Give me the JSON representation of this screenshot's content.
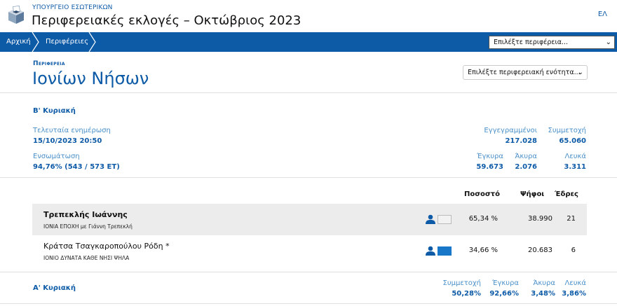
{
  "header": {
    "ministry": "ΥΠΟΥΡΓΕΙΟ ΕΣΩΤΕΡΙΚΩΝ",
    "title": "Περιφερειακές εκλογές – Οκτώβριος 2023",
    "lang": "ΕΛ"
  },
  "nav": {
    "crumbs": [
      "Αρχική",
      "Περιφέρειες"
    ],
    "region_select": "Επιλέξτε περιφέρεια..."
  },
  "region": {
    "label": "Περιφερεια",
    "name": "Ιονίων Νήσων",
    "unit_select": "Επιλέξτε περιφερειακή ενότητα..."
  },
  "round2": {
    "title": "Β' Κυριακή",
    "last_update_label": "Τελευταία ενημέρωση",
    "last_update": "15/10/2023 20:50",
    "integration_label": "Ενσωμάτωση",
    "integration": "94,76% (543 / 573 ΕΤ)",
    "registered_label": "Εγγεγραμμένοι",
    "registered": "217.028",
    "turnout_label": "Συμμετοχή",
    "turnout": "65.060",
    "valid_label": "Έγκυρα",
    "valid": "59.673",
    "invalid_label": "Άκυρα",
    "invalid": "2.076",
    "blank_label": "Λευκά",
    "blank": "3.311"
  },
  "results": {
    "headers": {
      "percent": "Ποσοστό",
      "votes": "Ψήφοι",
      "seats": "Έδρες"
    },
    "candidates": [
      {
        "name": "Τρεπεκλής Ιωάννης",
        "party": "ΙΟΝΙΑ ΕΠΟΧΗ με Γιάννη Τρεπεκλή",
        "percent": "65,34 %",
        "votes": "38.990",
        "seats": "21",
        "color": "#f2f2f2"
      },
      {
        "name": "Κράτσα Τσαγκαροπούλου Ρόδη *",
        "party": "ΙΟΝΙΟ ΔΥΝΑΤΑ ΚΑΘΕ ΝΗΣΙ ΨΗΛΑ",
        "percent": "34,66 %",
        "votes": "20.683",
        "seats": "6",
        "color": "#1877c9"
      }
    ]
  },
  "round1": {
    "title": "Α' Κυριακή",
    "turnout_label": "Συμμετοχή",
    "turnout": "50,28%",
    "valid_label": "Έγκυρα",
    "valid": "92,66%",
    "invalid_label": "Άκυρα",
    "invalid": "3,48%",
    "blank_label": "Λευκά",
    "blank": "3,86%"
  },
  "colors": {
    "brand": "#0d5aa7",
    "accent_light": "#4a90c9",
    "winner_bg": "#ececec"
  },
  "icons": [
    "ballot-box-logo",
    "person-icon",
    "chevron-down-icon"
  ]
}
